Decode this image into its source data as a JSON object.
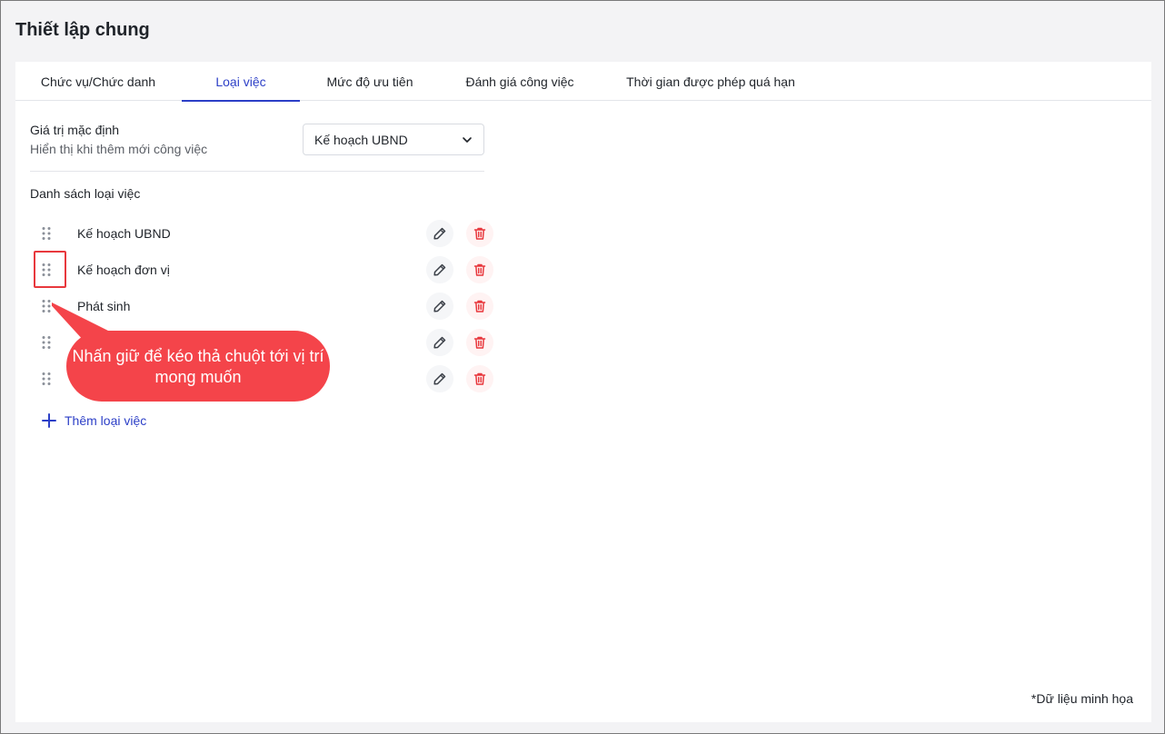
{
  "page": {
    "title": "Thiết lập chung"
  },
  "tabs": [
    {
      "label": "Chức vụ/Chức danh",
      "active": false
    },
    {
      "label": "Loại việc",
      "active": true
    },
    {
      "label": "Mức độ ưu tiên",
      "active": false
    },
    {
      "label": "Đánh giá công việc",
      "active": false
    },
    {
      "label": "Thời gian được phép quá hạn",
      "active": false
    }
  ],
  "default_value": {
    "label": "Giá trị mặc định",
    "description": "Hiển thị khi thêm mới công việc",
    "selected": "Kế hoạch UBND"
  },
  "list": {
    "title": "Danh sách loại việc",
    "items": [
      {
        "label": "Kế hoạch UBND"
      },
      {
        "label": "Kế hoạch đơn vị"
      },
      {
        "label": "Phát sinh"
      },
      {
        "label": ""
      },
      {
        "label": ""
      }
    ],
    "add_label": "Thêm loại việc"
  },
  "callout": {
    "text": "Nhấn giữ để kéo thả chuột tới vị trí mong muốn"
  },
  "footnote": "*Dữ liệu minh họa",
  "colors": {
    "accent": "#2c3fc7",
    "danger": "#e8383d",
    "callout": "#f4444a"
  },
  "icons": {
    "edit": "pencil-icon",
    "delete": "trash-icon",
    "drag": "drag-handle-icon",
    "add": "plus-icon",
    "dropdown": "chevron-down-icon"
  }
}
